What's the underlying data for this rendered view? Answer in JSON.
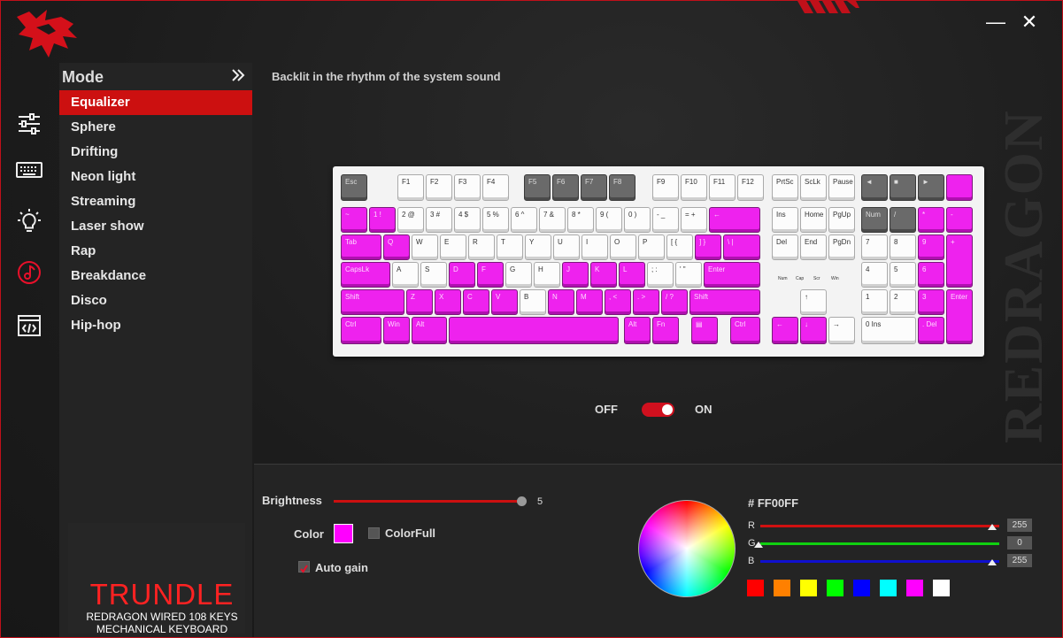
{
  "window": {
    "minimize_glyph": "—",
    "close_glyph": "✕"
  },
  "colors": {
    "accent": "#cc1010",
    "selected_color": "#FF00FF",
    "panel": "#242424"
  },
  "sidebar_icons": [
    "sliders-icon",
    "keyboard-icon",
    "lightbulb-icon",
    "music-note-icon",
    "code-window-icon"
  ],
  "mode_panel": {
    "title": "Mode",
    "items": [
      "Equalizer",
      "Sphere",
      "Drifting",
      "Neon light",
      "Streaming",
      "Laser show",
      "Rap",
      "Breakdance",
      "Disco",
      "Hip-hop"
    ],
    "selected": "Equalizer"
  },
  "product": {
    "name": "TRUNDLE",
    "line1": "REDRAGON WIRED 108 KEYS",
    "line2": "MECHANICAL KEYBOARD"
  },
  "main": {
    "subtitle": "Backlit in the rhythm of the system sound",
    "watermark": "REDRAGON"
  },
  "keyboard": {
    "row0": [
      {
        "t": "Esc",
        "c": "g"
      },
      {
        "t": "F1",
        "c": "w"
      },
      {
        "t": "F2",
        "c": "w"
      },
      {
        "t": "F3",
        "c": "w"
      },
      {
        "t": "F4",
        "c": "w"
      },
      {
        "t": "F5",
        "c": "g"
      },
      {
        "t": "F6",
        "c": "g"
      },
      {
        "t": "F7",
        "c": "g"
      },
      {
        "t": "F8",
        "c": "g"
      },
      {
        "t": "F9",
        "c": "w"
      },
      {
        "t": "F10",
        "c": "w"
      },
      {
        "t": "F11",
        "c": "w"
      },
      {
        "t": "F12",
        "c": "w"
      },
      {
        "t": "PrtSc",
        "c": "w"
      },
      {
        "t": "ScLk",
        "c": "w"
      },
      {
        "t": "Pause",
        "c": "w"
      },
      {
        "t": "◄",
        "c": "g"
      },
      {
        "t": "■",
        "c": "g"
      },
      {
        "t": "►",
        "c": "g"
      },
      {
        "t": "",
        "c": "p"
      }
    ],
    "row1": [
      {
        "t": "~",
        "c": "p"
      },
      {
        "t": "1 !",
        "c": "p"
      },
      {
        "t": "2 @",
        "c": "w"
      },
      {
        "t": "3 #",
        "c": "w"
      },
      {
        "t": "4 $",
        "c": "w"
      },
      {
        "t": "5 %",
        "c": "w"
      },
      {
        "t": "6 ^",
        "c": "w"
      },
      {
        "t": "7 &",
        "c": "w"
      },
      {
        "t": "8 *",
        "c": "w"
      },
      {
        "t": "9 (",
        "c": "w"
      },
      {
        "t": "0 )",
        "c": "w"
      },
      {
        "t": "- _",
        "c": "w"
      },
      {
        "t": "= +",
        "c": "w"
      },
      {
        "t": "←",
        "c": "p"
      },
      {
        "t": "Ins",
        "c": "w"
      },
      {
        "t": "Home",
        "c": "w"
      },
      {
        "t": "PgUp",
        "c": "w"
      },
      {
        "t": "Num",
        "c": "g"
      },
      {
        "t": "/",
        "c": "g"
      },
      {
        "t": "*",
        "c": "p"
      },
      {
        "t": "-",
        "c": "p"
      }
    ],
    "row2": [
      {
        "t": "Tab",
        "c": "p"
      },
      {
        "t": "Q",
        "c": "p"
      },
      {
        "t": "W",
        "c": "w"
      },
      {
        "t": "E",
        "c": "w"
      },
      {
        "t": "R",
        "c": "w"
      },
      {
        "t": "T",
        "c": "w"
      },
      {
        "t": "Y",
        "c": "w"
      },
      {
        "t": "U",
        "c": "w"
      },
      {
        "t": "I",
        "c": "w"
      },
      {
        "t": "O",
        "c": "w"
      },
      {
        "t": "P",
        "c": "w"
      },
      {
        "t": "[ {",
        "c": "w"
      },
      {
        "t": "] }",
        "c": "p"
      },
      {
        "t": "\\ |",
        "c": "p"
      },
      {
        "t": "Del",
        "c": "w"
      },
      {
        "t": "End",
        "c": "w"
      },
      {
        "t": "PgDn",
        "c": "w"
      },
      {
        "t": "7",
        "c": "w"
      },
      {
        "t": "8",
        "c": "w"
      },
      {
        "t": "9",
        "c": "p"
      },
      {
        "t": "+",
        "c": "p"
      }
    ],
    "row3": [
      {
        "t": "CapsLk",
        "c": "p"
      },
      {
        "t": "A",
        "c": "w"
      },
      {
        "t": "S",
        "c": "w"
      },
      {
        "t": "D",
        "c": "p"
      },
      {
        "t": "F",
        "c": "p"
      },
      {
        "t": "G",
        "c": "w"
      },
      {
        "t": "H",
        "c": "w"
      },
      {
        "t": "J",
        "c": "p"
      },
      {
        "t": "K",
        "c": "p"
      },
      {
        "t": "L",
        "c": "p"
      },
      {
        "t": "; :",
        "c": "w"
      },
      {
        "t": "' \"",
        "c": "w"
      },
      {
        "t": "Enter",
        "c": "p"
      },
      {
        "t": "4",
        "c": "w"
      },
      {
        "t": "5",
        "c": "w"
      },
      {
        "t": "6",
        "c": "p"
      }
    ],
    "row4": [
      {
        "t": "Shift",
        "c": "p"
      },
      {
        "t": "Z",
        "c": "p"
      },
      {
        "t": "X",
        "c": "p"
      },
      {
        "t": "C",
        "c": "p"
      },
      {
        "t": "V",
        "c": "p"
      },
      {
        "t": "B",
        "c": "w"
      },
      {
        "t": "N",
        "c": "p"
      },
      {
        "t": "M",
        "c": "p"
      },
      {
        "t": ", <",
        "c": "p"
      },
      {
        "t": ". >",
        "c": "p"
      },
      {
        "t": "/ ?",
        "c": "p"
      },
      {
        "t": "Shift",
        "c": "p"
      },
      {
        "t": "↑",
        "c": "w"
      },
      {
        "t": "1",
        "c": "w"
      },
      {
        "t": "2",
        "c": "w"
      },
      {
        "t": "3",
        "c": "p"
      },
      {
        "t": "Enter",
        "c": "p"
      }
    ],
    "row5": [
      {
        "t": "Ctrl",
        "c": "p"
      },
      {
        "t": "Win",
        "c": "p"
      },
      {
        "t": "Alt",
        "c": "p"
      },
      {
        "t": "",
        "c": "p"
      },
      {
        "t": "Alt",
        "c": "p"
      },
      {
        "t": "Fn",
        "c": "p"
      },
      {
        "t": "▤",
        "c": "p"
      },
      {
        "t": "Ctrl",
        "c": "p"
      },
      {
        "t": "←",
        "c": "p"
      },
      {
        "t": "↓",
        "c": "p"
      },
      {
        "t": "→",
        "c": "w"
      },
      {
        "t": "0 Ins",
        "c": "w"
      },
      {
        "t": ". Del",
        "c": "p"
      }
    ],
    "leds": [
      "Num",
      "Cap",
      "Scr",
      "Win"
    ]
  },
  "toggle": {
    "off_label": "OFF",
    "on_label": "ON",
    "state": "on"
  },
  "controls": {
    "brightness_label": "Brightness",
    "brightness_value": "5",
    "brightness_fraction": 1.0,
    "color_label": "Color",
    "colorfull_label": "ColorFull",
    "colorfull_checked": false,
    "autogain_label": "Auto gain",
    "autogain_checked": true
  },
  "picker": {
    "hex": "# FF00FF",
    "r_label": "R",
    "g_label": "G",
    "b_label": "B",
    "r": "255",
    "g": "0",
    "b": "255",
    "r_fraction": 1.0,
    "g_fraction": 0.0,
    "b_fraction": 1.0,
    "presets": [
      "#ff0000",
      "#ff8000",
      "#ffff00",
      "#00ff00",
      "#0000ff",
      "#00ffff",
      "#ff00ff",
      "#ffffff"
    ]
  }
}
